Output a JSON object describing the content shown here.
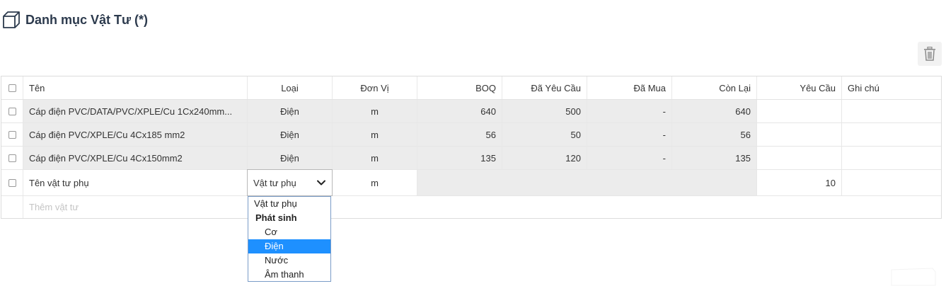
{
  "header": {
    "title": "Danh mục Vật Tư (*)",
    "icon": "box-icon"
  },
  "toolbar": {
    "delete_icon": "trash-icon"
  },
  "table": {
    "columns": [
      "Tên",
      "Loại",
      "Đơn Vị",
      "BOQ",
      "Đã Yêu Cầu",
      "Đã Mua",
      "Còn Lại",
      "Yêu Cầu",
      "Ghi chú"
    ],
    "rows": [
      {
        "ten": "Cáp điện PVC/DATA/PVC/XPLE/Cu 1Cx240mm...",
        "loai": "Điện",
        "don_vi": "m",
        "boq": "640",
        "da_yeu_cau": "500",
        "da_mua": "-",
        "con_lai": "640",
        "yeu_cau": "",
        "ghi_chu": ""
      },
      {
        "ten": "Cáp điện PVC/XPLE/Cu 4Cx185 mm2",
        "loai": "Điện",
        "don_vi": "m",
        "boq": "56",
        "da_yeu_cau": "50",
        "da_mua": "-",
        "con_lai": "56",
        "yeu_cau": "",
        "ghi_chu": ""
      },
      {
        "ten": "Cáp điện PVC/XPLE/Cu 4Cx150mm2",
        "loai": "Điện",
        "don_vi": "m",
        "boq": "135",
        "da_yeu_cau": "120",
        "da_mua": "-",
        "con_lai": "135",
        "yeu_cau": "",
        "ghi_chu": ""
      }
    ],
    "edit_row": {
      "ten": "Tên vật tư phụ",
      "loai_selected": "Vật tư phụ",
      "don_vi": "m",
      "yeu_cau": "10",
      "ghi_chu": ""
    },
    "add_placeholder": "Thêm vật tư"
  },
  "dropdown": {
    "options": [
      {
        "label": "Vật tư phụ",
        "kind": "item"
      },
      {
        "label": "Phát sinh",
        "kind": "group"
      },
      {
        "label": "Cơ",
        "kind": "child"
      },
      {
        "label": "Điện",
        "kind": "child",
        "highlighted": true
      },
      {
        "label": "Nước",
        "kind": "child"
      },
      {
        "label": "Âm thanh",
        "kind": "child"
      }
    ]
  },
  "colors": {
    "highlight": "#1e90ff",
    "readonly_bg": "#ececec",
    "title": "#2c3a4d"
  }
}
